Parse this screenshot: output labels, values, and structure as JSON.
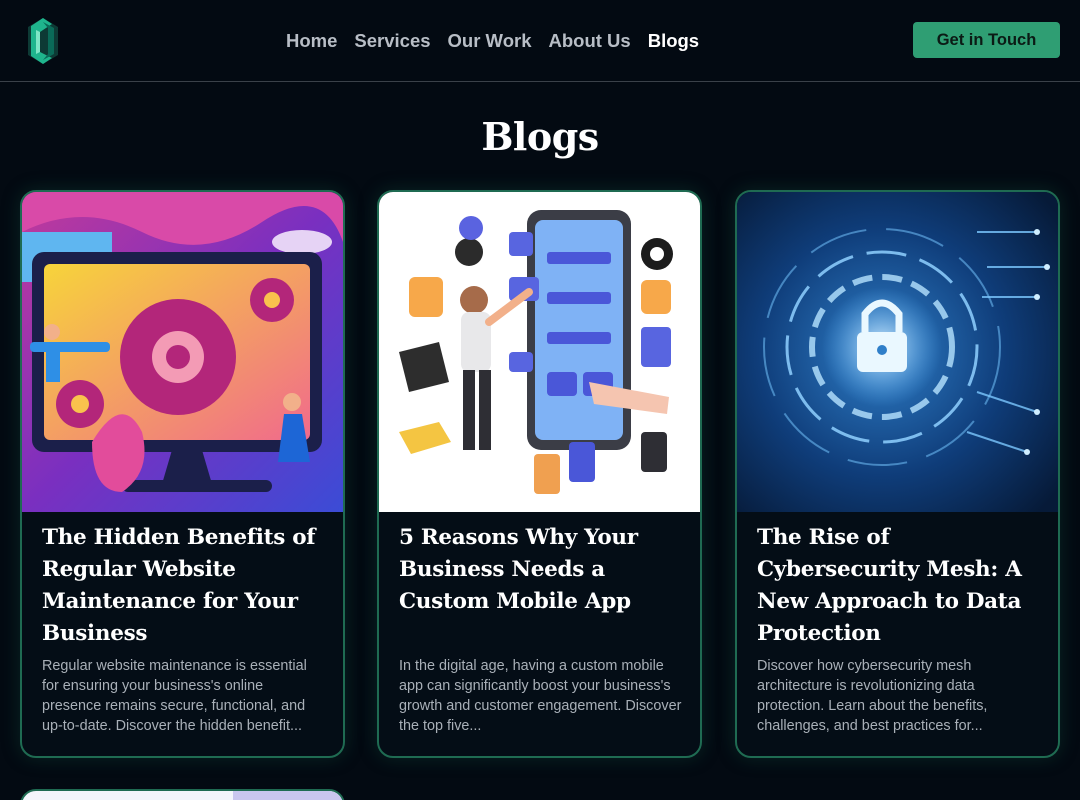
{
  "nav": {
    "items": [
      {
        "label": "Home",
        "active": false
      },
      {
        "label": "Services",
        "active": false
      },
      {
        "label": "Our Work",
        "active": false
      },
      {
        "label": "About Us",
        "active": false
      },
      {
        "label": "Blogs",
        "active": true
      }
    ],
    "cta_label": "Get in Touch",
    "logo_icon": "brand-logo-icon"
  },
  "page": {
    "title": "Blogs"
  },
  "cards": [
    {
      "title": "The Hidden Benefits of Regular Website Maintenance for Your Business",
      "excerpt": "Regular website maintenance is essential for ensuring your business's online presence remains secure, functional, and up-to-date. Discover the hidden benefit...",
      "image_icon": "website-maintenance-illustration"
    },
    {
      "title": "5 Reasons Why Your Business Needs a Custom Mobile App",
      "excerpt": "In the digital age, having a custom mobile app can significantly boost your business's growth and customer engagement. Discover the top five...",
      "image_icon": "mobile-app-illustration"
    },
    {
      "title": "The Rise of Cybersecurity Mesh: A New Approach to Data Protection",
      "excerpt": "Discover how cybersecurity mesh architecture is revolutionizing data protection. Learn about the benefits, challenges, and best practices for...",
      "image_icon": "cybersecurity-lock-illustration"
    }
  ],
  "colors": {
    "background": "#030a12",
    "accent": "#2f9e73",
    "card_border": "#1f6b52"
  }
}
